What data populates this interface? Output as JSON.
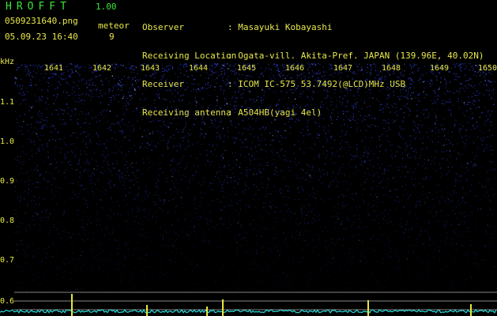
{
  "header": {
    "app_name": "HROFFT",
    "version": "1.00",
    "file_name": "0509231640.png",
    "datetime": "05.09.23 16:40",
    "meteor_label": "meteor",
    "meteor_count": "9"
  },
  "info": {
    "labels": [
      "Observer",
      "Receiving Location",
      "Receiver",
      "Receiving antenna"
    ],
    "values": [
      ": Masayuki Kobayashi",
      ": Ogata-vill. Akita-Pref. JAPAN (139.96E, 40.02N)",
      ": ICOM IC-575 53.7492(@LCD)MHz USB",
      ": A504HB(yagi 4el)"
    ]
  },
  "spectrogram": {
    "unit_label": "kHz",
    "time_labels": [
      "1641",
      "1642",
      "1643",
      "1644",
      "1645",
      "1646",
      "1647",
      "1648",
      "1649",
      "1650"
    ],
    "freq_labels": [
      "1.1",
      "1.0",
      "0.9",
      "0.8",
      "0.7",
      "0.6"
    ],
    "colors": {
      "background": "#000000",
      "noise": "#2838c8",
      "text": "#e8e84a",
      "trace": "#28d8d8",
      "spike": "#e8e83a",
      "grid": "#b0b0b0"
    }
  }
}
